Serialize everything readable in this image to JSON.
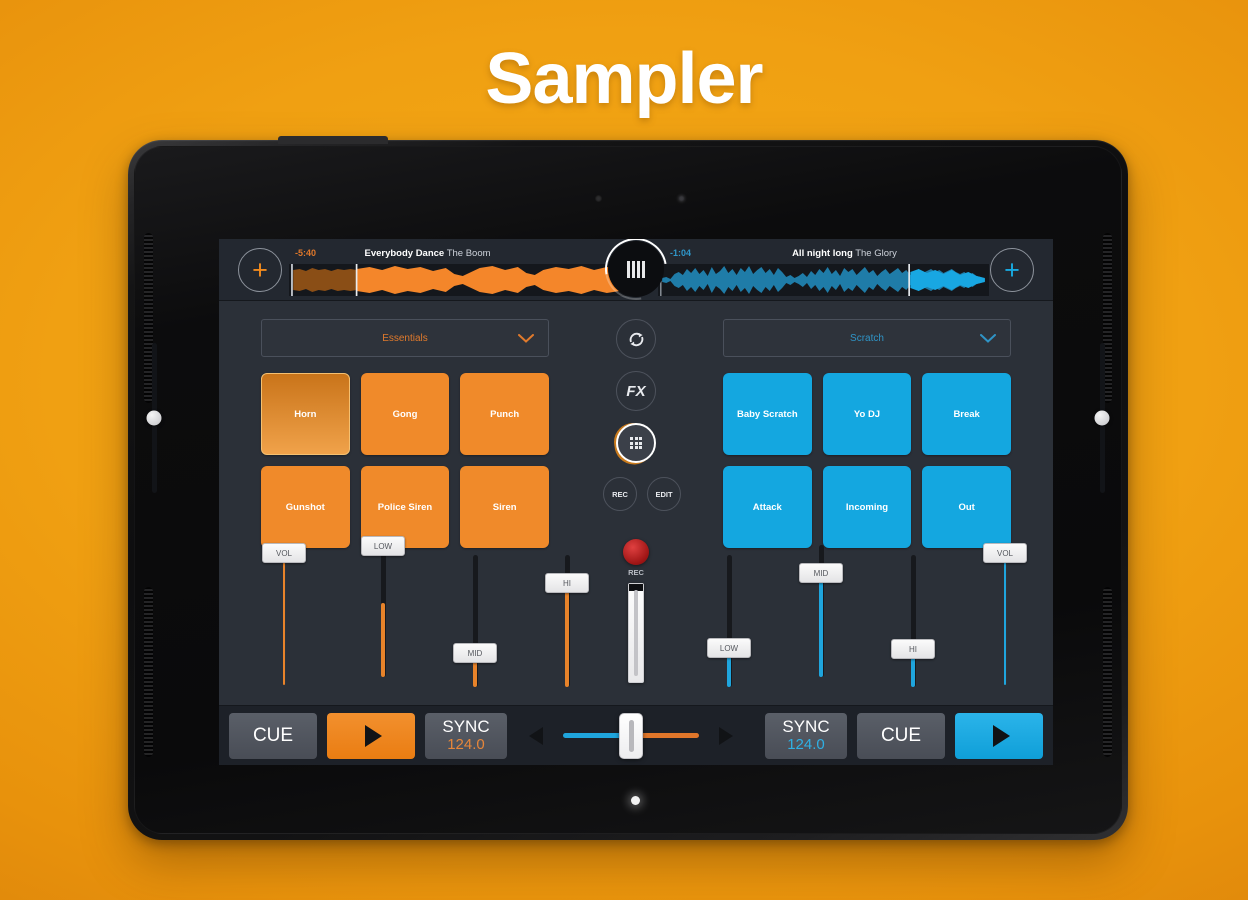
{
  "page": {
    "title": "Sampler"
  },
  "decks": {
    "left": {
      "add_label": "+",
      "time": "-5:40",
      "track_title": "Everybody Dance",
      "track_artist": "The Boom",
      "accent": "#f08a2a",
      "progress_pct": 20
    },
    "right": {
      "add_label": "+",
      "time": "-1:04",
      "track_title": "All night long",
      "track_artist": "The Glory",
      "accent": "#14a7e0",
      "progress_pct": 76
    }
  },
  "jog_wheel": {
    "name": "jog-wheel",
    "bars": 4
  },
  "sampler": {
    "left": {
      "bank_label": "Essentials",
      "pads": [
        {
          "label": "Horn",
          "active": true
        },
        {
          "label": "Gong",
          "active": false
        },
        {
          "label": "Punch",
          "active": false
        },
        {
          "label": "Gunshot",
          "active": false
        },
        {
          "label": "Police Siren",
          "active": false
        },
        {
          "label": "Siren",
          "active": false
        }
      ]
    },
    "right": {
      "bank_label": "Scratch",
      "pads": [
        {
          "label": "Baby Scratch",
          "active": false
        },
        {
          "label": "Yo DJ",
          "active": false
        },
        {
          "label": "Break",
          "active": false
        },
        {
          "label": "Attack",
          "active": false
        },
        {
          "label": "Incoming",
          "active": false
        },
        {
          "label": "Out",
          "active": false
        }
      ]
    }
  },
  "center_controls": {
    "loop_label": "",
    "fx_label": "FX",
    "grid_label": "",
    "rec_label": "REC",
    "edit_label": "EDIT"
  },
  "mixer": {
    "rec_button_label": "REC",
    "master_level_pct": 100,
    "left_faders": [
      {
        "label": "VOL",
        "value_pct": 100
      },
      {
        "label": "LOW",
        "value_pct": 56
      },
      {
        "label": "MID",
        "value_pct": 26
      },
      {
        "label": "HI",
        "value_pct": 79
      }
    ],
    "right_faders": [
      {
        "label": "LOW",
        "value_pct": 30
      },
      {
        "label": "MID",
        "value_pct": 79
      },
      {
        "label": "HI",
        "value_pct": 29
      },
      {
        "label": "VOL",
        "value_pct": 100
      }
    ]
  },
  "transport": {
    "left": {
      "cue_label": "CUE",
      "play_label": "play-icon",
      "sync_label": "SYNC",
      "bpm": "124.0"
    },
    "right": {
      "sync_label": "SYNC",
      "bpm": "124.0",
      "cue_label": "CUE",
      "play_label": "play-icon"
    },
    "crossfader": {
      "position_pct": 50,
      "left_color": "#1fa5dd",
      "right_color": "#e0762a"
    }
  },
  "edge_sliders": [
    {
      "name": "left-edge-slider",
      "value_pct": 50
    },
    {
      "name": "right-edge-slider",
      "value_pct": 50
    }
  ]
}
